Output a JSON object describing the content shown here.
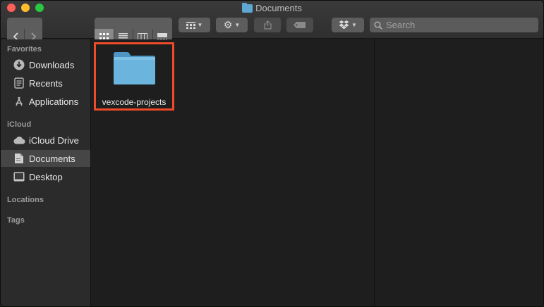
{
  "window": {
    "title": "Documents"
  },
  "toolbar": {
    "back_icon": "chevron-left-icon",
    "forward_icon": "chevron-right-icon",
    "search_placeholder": "Search"
  },
  "sidebar": {
    "sections": {
      "favorites": "Favorites",
      "icloud": "iCloud",
      "locations": "Locations",
      "tags": "Tags"
    },
    "favorites": [
      {
        "label": "Downloads",
        "icon": "download-icon"
      },
      {
        "label": "Recents",
        "icon": "recents-icon"
      },
      {
        "label": "Applications",
        "icon": "applications-icon"
      }
    ],
    "icloud": [
      {
        "label": "iCloud Drive",
        "icon": "cloud-icon"
      },
      {
        "label": "Documents",
        "icon": "document-icon",
        "selected": true
      },
      {
        "label": "Desktop",
        "icon": "desktop-icon"
      }
    ]
  },
  "content": {
    "items": [
      {
        "name": "vexcode-projects",
        "type": "folder",
        "highlighted": true
      }
    ]
  },
  "colors": {
    "highlight": "#ef4a2a",
    "folder": "#5da7d2",
    "selected_row": "#464646"
  }
}
